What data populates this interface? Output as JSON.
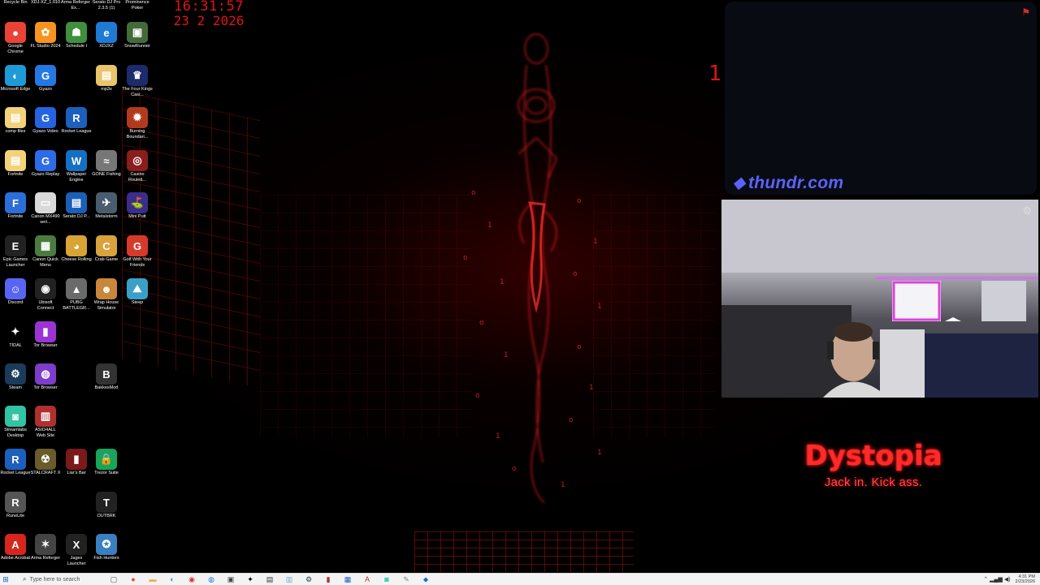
{
  "clock": {
    "time": "16:31:57",
    "date": "23 2 2026"
  },
  "top_row_labels": [
    {
      "label": "Recycle Bin"
    },
    {
      "label": "XDJ-XZ_1.010"
    },
    {
      "label": "Arma Reforger Ex..."
    },
    {
      "label": "Serato DJ Pro 2.3.5 (1)"
    },
    {
      "label": "Prominence Poker"
    }
  ],
  "desktop_icons": [
    {
      "label": "Google Chrome",
      "glyph": "●",
      "color": "#ea4335"
    },
    {
      "label": "FL Studio 2024",
      "glyph": "✿",
      "color": "#f7931e"
    },
    {
      "label": "Schedule I",
      "glyph": "☗",
      "color": "#3f8f3f"
    },
    {
      "label": "XDJXZ",
      "glyph": "e",
      "color": "#1f7ad6"
    },
    {
      "label": "SnowRunner",
      "glyph": "▣",
      "color": "#446a3a"
    },
    {
      "label": "Microsoft Edge",
      "glyph": "◐",
      "color": "#1e9bd7"
    },
    {
      "label": "Gyazo",
      "glyph": "G",
      "color": "#2478e4"
    },
    {
      "label": "mp3s",
      "glyph": "▤",
      "color": "#e8c46a"
    },
    {
      "label": "The Four Kings Casi...",
      "glyph": "♛",
      "color": "#1b2b6b"
    },
    {
      "label": "comp files",
      "glyph": "▤",
      "color": "#f2d27a"
    },
    {
      "label": "Gyazo Video",
      "glyph": "G",
      "color": "#2563e0"
    },
    {
      "label": "Rocket League",
      "glyph": "R",
      "color": "#1d5fbd"
    },
    {
      "label": "Burning Boundari...",
      "glyph": "✹",
      "color": "#b23a1c"
    },
    {
      "label": "Fortnite",
      "glyph": "▤",
      "color": "#f2d27a"
    },
    {
      "label": "Gyazo Replay",
      "glyph": "G",
      "color": "#2e6be6"
    },
    {
      "label": "Wallpaper Engine",
      "glyph": "W",
      "color": "#1570c4"
    },
    {
      "label": "GONE Fishing",
      "glyph": "≈",
      "color": "#777777"
    },
    {
      "label": "Casino Roulett...",
      "glyph": "◎",
      "color": "#8a1d1d"
    },
    {
      "label": "Fortnite",
      "glyph": "F",
      "color": "#2b6ed8"
    },
    {
      "label": "Canon MX490 seri...",
      "glyph": "▭",
      "color": "#d9d9d9"
    },
    {
      "label": "Serato DJ P...",
      "glyph": "▤",
      "color": "#1a5fb8"
    },
    {
      "label": "Metalstorm",
      "glyph": "✈",
      "color": "#4a5d6e"
    },
    {
      "label": "Mini Putt",
      "glyph": "⛳",
      "color": "#3a2e8a"
    },
    {
      "label": "Epic Games Launcher",
      "glyph": "E",
      "color": "#222222"
    },
    {
      "label": "Canon Quick Menu",
      "glyph": "▦",
      "color": "#4a7b3f"
    },
    {
      "label": "Cheese Rolling",
      "glyph": "◕",
      "color": "#d8a436"
    },
    {
      "label": "Crab Game",
      "glyph": "C",
      "color": "#d9a23c"
    },
    {
      "label": "Golf With Your Friends",
      "glyph": "G",
      "color": "#d63a2a"
    },
    {
      "label": "Discord",
      "glyph": "☺",
      "color": "#5865f2"
    },
    {
      "label": "Ubisoft Connect",
      "glyph": "◉",
      "color": "#222222"
    },
    {
      "label": "PUBG BATTLEGR...",
      "glyph": "▲",
      "color": "#6a6a6a"
    },
    {
      "label": "Wrap House Simulator",
      "glyph": "☻",
      "color": "#c8873a"
    },
    {
      "label": "Steep",
      "glyph": "⛰",
      "color": "#3aa0c8"
    },
    {
      "label": "TIDAL",
      "glyph": "✦",
      "color": "#000000"
    },
    {
      "label": "Tor Browser",
      "glyph": "▮",
      "color": "#9b34d3"
    },
    {
      "label": "Steam",
      "glyph": "⚙",
      "color": "#1b3b5a"
    },
    {
      "label": "Tor Browser",
      "glyph": "◍",
      "color": "#7d3cc9"
    },
    {
      "label": "BakkesMod",
      "glyph": "B",
      "color": "#333333"
    },
    {
      "label": "Streamlabs Desktop",
      "glyph": "◙",
      "color": "#31c3a2"
    },
    {
      "label": "ASIO4ALL Web Site",
      "glyph": "▥",
      "color": "#b03030"
    },
    {
      "label": "Rocket League",
      "glyph": "R",
      "color": "#1d5fbd"
    },
    {
      "label": "STALCRAFT X",
      "glyph": "☢",
      "color": "#6b5a2a"
    },
    {
      "label": "Liar's Bar",
      "glyph": "▮",
      "color": "#7a1a1a"
    },
    {
      "label": "Trezor Suite",
      "glyph": "🔒",
      "color": "#1aa35a"
    },
    {
      "label": "RuneLite",
      "glyph": "R",
      "color": "#555555"
    },
    {
      "label": "OUTBRK",
      "glyph": "T",
      "color": "#222222"
    },
    {
      "label": "Adobe Acrobat",
      "glyph": "A",
      "color": "#d7271c"
    },
    {
      "label": "Arma Reforger",
      "glyph": "✶",
      "color": "#444444"
    },
    {
      "label": "Jagex Launcher",
      "glyph": "X",
      "color": "#222222"
    },
    {
      "label": "Fish Hunters",
      "glyph": "✪",
      "color": "#3a7fc0"
    }
  ],
  "thundr": {
    "logo_text": "thundr.com",
    "flag_icon": "report-flag-icon"
  },
  "webcam": {
    "settings_icon": "webcam-settings-icon"
  },
  "dystopia": {
    "title": "Dystopia",
    "tagline": "Jack in. Kick ass."
  },
  "red_glyph": "1",
  "taskbar": {
    "search_placeholder": "Type here to search",
    "apps": [
      "chrome",
      "files",
      "edge",
      "mail",
      "store",
      "steam",
      "folder",
      "explorer",
      "tidal",
      "discord",
      "app"
    ],
    "tray_time": "4:31 PM",
    "tray_date": "2/23/2026"
  }
}
